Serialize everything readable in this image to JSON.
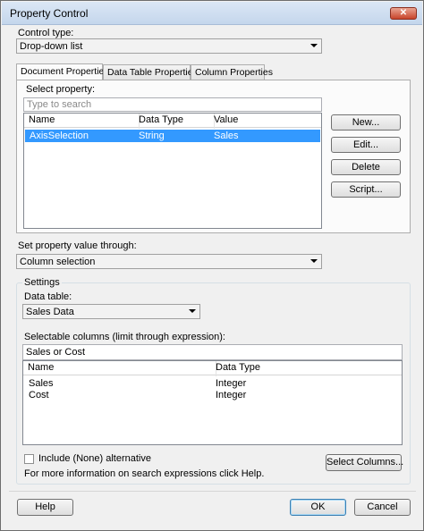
{
  "window": {
    "title": "Property Control",
    "close_glyph": "✕"
  },
  "control_type": {
    "label": "Control type:",
    "value": "Drop-down list"
  },
  "tabs": [
    {
      "label": "Document Properties",
      "active": true
    },
    {
      "label": "Data Table Properties",
      "active": false
    },
    {
      "label": "Column Properties",
      "active": false
    }
  ],
  "select_property": {
    "label": "Select property:",
    "search_placeholder": "Type to search",
    "columns": [
      "Name",
      "Data Type",
      "Value"
    ],
    "rows": [
      {
        "name": "AxisSelection",
        "type": "String",
        "value": "Sales",
        "selected": true
      }
    ]
  },
  "property_buttons": {
    "new": "New...",
    "edit": "Edit...",
    "delete": "Delete",
    "script": "Script..."
  },
  "set_value": {
    "label": "Set property value through:",
    "value": "Column selection"
  },
  "settings": {
    "group_label": "Settings",
    "data_table_label": "Data table:",
    "data_table_value": "Sales Data",
    "selectable_label": "Selectable columns (limit through expression):",
    "expression_value": "Sales or Cost",
    "columns": [
      "Name",
      "Data Type"
    ],
    "rows": [
      {
        "name": "Sales",
        "type": "Integer"
      },
      {
        "name": "Cost",
        "type": "Integer"
      }
    ],
    "include_none_label": "Include (None) alternative",
    "include_none_checked": false,
    "info_text": "For more information on search expressions click Help.",
    "select_columns_button": "Select Columns..."
  },
  "footer": {
    "help": "Help",
    "ok": "OK",
    "cancel": "Cancel"
  },
  "colors": {
    "selection": "#3399ff",
    "window_bg": "#f0f0f0",
    "title_bar": "#c4d6ec"
  }
}
